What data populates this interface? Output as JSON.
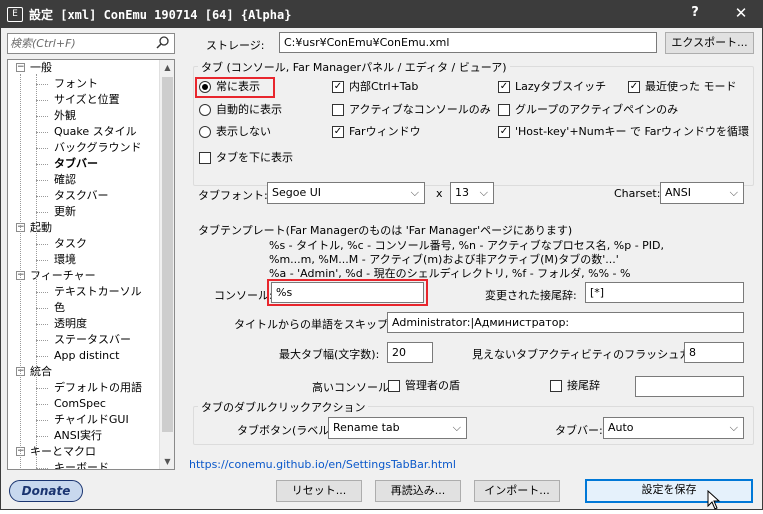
{
  "window": {
    "title": "設定 [xml] ConEmu 190714 [64] {Alpha}",
    "help": "?",
    "close": "✕",
    "app_icon": "E"
  },
  "search": {
    "placeholder": "検索(Ctrl+F)"
  },
  "tree": [
    {
      "label": "一般",
      "level": 0,
      "expander": "−"
    },
    {
      "label": "フォント",
      "level": 1
    },
    {
      "label": "サイズと位置",
      "level": 1
    },
    {
      "label": "外観",
      "level": 1
    },
    {
      "label": "Quake スタイル",
      "level": 1
    },
    {
      "label": "バックグラウンド",
      "level": 1
    },
    {
      "label": "タブバー",
      "level": 1,
      "selected": true
    },
    {
      "label": "確認",
      "level": 1
    },
    {
      "label": "タスクバー",
      "level": 1
    },
    {
      "label": "更新",
      "level": 1
    },
    {
      "label": "起動",
      "level": 0,
      "expander": "−"
    },
    {
      "label": "タスク",
      "level": 1
    },
    {
      "label": "環境",
      "level": 1
    },
    {
      "label": "フィーチャー",
      "level": 0,
      "expander": "−"
    },
    {
      "label": "テキストカーソル",
      "level": 1
    },
    {
      "label": "色",
      "level": 1
    },
    {
      "label": "透明度",
      "level": 1
    },
    {
      "label": "ステータスバー",
      "level": 1
    },
    {
      "label": "App distinct",
      "level": 1
    },
    {
      "label": "統合",
      "level": 0,
      "expander": "−"
    },
    {
      "label": "デフォルトの用語",
      "level": 1
    },
    {
      "label": "ComSpec",
      "level": 1
    },
    {
      "label": "チャイルドGUI",
      "level": 1
    },
    {
      "label": "ANSI実行",
      "level": 1
    },
    {
      "label": "キーとマクロ",
      "level": 0,
      "expander": "−"
    },
    {
      "label": "キーボード",
      "level": 1
    }
  ],
  "storage": {
    "label": "ストレージ:",
    "path": "C:¥usr¥ConEmu¥ConEmu.xml",
    "export_button": "エクスポート..."
  },
  "tabs_group": {
    "legend": "タブ (コンソール, Far Managerパネル / エディタ / ビューア)",
    "radio": [
      {
        "label": "常に表示",
        "checked": true
      },
      {
        "label": "自動的に表示",
        "checked": false
      },
      {
        "label": "表示しない",
        "checked": false
      }
    ],
    "col2": [
      {
        "label": "内部Ctrl+Tab",
        "checked": true
      },
      {
        "label": "アクティブなコンソールのみ",
        "checked": false
      },
      {
        "label": "Farウィンドウ",
        "checked": true
      }
    ],
    "col3": [
      {
        "label": "Lazyタブスイッチ",
        "checked": true
      },
      {
        "label": "グループのアクティブペインのみ",
        "checked": false
      },
      {
        "label": "'Host-key'+Numキー で Farウィンドウを循環",
        "checked": true
      }
    ],
    "col4": [
      {
        "label": "最近使った モード",
        "checked": true
      }
    ],
    "tabs_bottom": {
      "label": "タブを下に表示",
      "checked": false
    }
  },
  "font": {
    "label": "タブフォント:",
    "value": "Segoe UI",
    "x": "x",
    "size": "13",
    "charset_label": "Charset:",
    "charset": "ANSI"
  },
  "template": {
    "heading": "タブテンプレート(Far Managerのものは 'Far Manager'ページにあります)",
    "help1": "%s - タイトル, %c - コンソール番号, %n - アクティブなプロセス名, %p - PID,",
    "help2": "%m...m, %M...M - アクティブ(m)および非アクティブ(M)タブの数'...'",
    "help3": "%a - 'Admin', %d - 現在のシェルディレクトリ, %f - フォルダ, %% - %",
    "console_label": "コンソール:",
    "console_value": "%s",
    "modified_label": "変更された接尾辞:",
    "modified_value": "[*]",
    "skip_label": "タイトルからの単語をスキップ:",
    "skip_value": "Administrator:|Администратор:",
    "maxwidth_label": "最大タブ幅(文字数):",
    "maxwidth_value": "20",
    "flash_label": "見えないタブアクティビティのフラッシュカウント:",
    "flash_value": "8",
    "high_label": "高いコンソール:",
    "admin_shield": {
      "label": "管理者の盾",
      "checked": false
    },
    "suffix": {
      "label": "接尾辞",
      "checked": false
    },
    "suffix_value": ""
  },
  "dblclick": {
    "legend": "タブのダブルクリックアクション",
    "tab_button_label": "タブボタン(ラベル):",
    "tab_button_value": "Rename tab",
    "tabbar_label": "タブバー:",
    "tabbar_value": "Auto"
  },
  "link": "https://conemu.github.io/en/SettingsTabBar.html",
  "footer": {
    "donate": "Donate",
    "reset": "リセット...",
    "reload": "再読込み...",
    "import": "インポート...",
    "save": "設定を保存"
  }
}
